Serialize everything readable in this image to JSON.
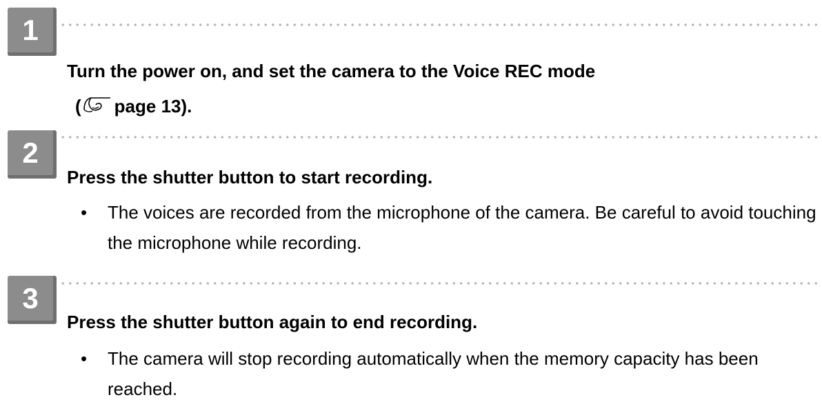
{
  "steps": [
    {
      "number": "1",
      "heading_line1": "Turn the power on, and set the camera to the Voice REC mode",
      "heading_line2_open": "(",
      "heading_line2_ref": "page 13).",
      "bullets": []
    },
    {
      "number": "2",
      "heading": "Press the shutter button to start recording.",
      "bullet": "The voices are recorded from the microphone of the camera. Be careful to avoid touching the microphone while recording."
    },
    {
      "number": "3",
      "heading": "Press the shutter button again to end recording.",
      "bullet": "The camera will stop recording automatically when the memory capacity has been reached."
    }
  ],
  "bullet_symbol": "•",
  "icons": {
    "page_reference": "pointing-hand-icon"
  },
  "colors": {
    "badge": "#8c8c8c",
    "dots": "#b5b5b5"
  }
}
